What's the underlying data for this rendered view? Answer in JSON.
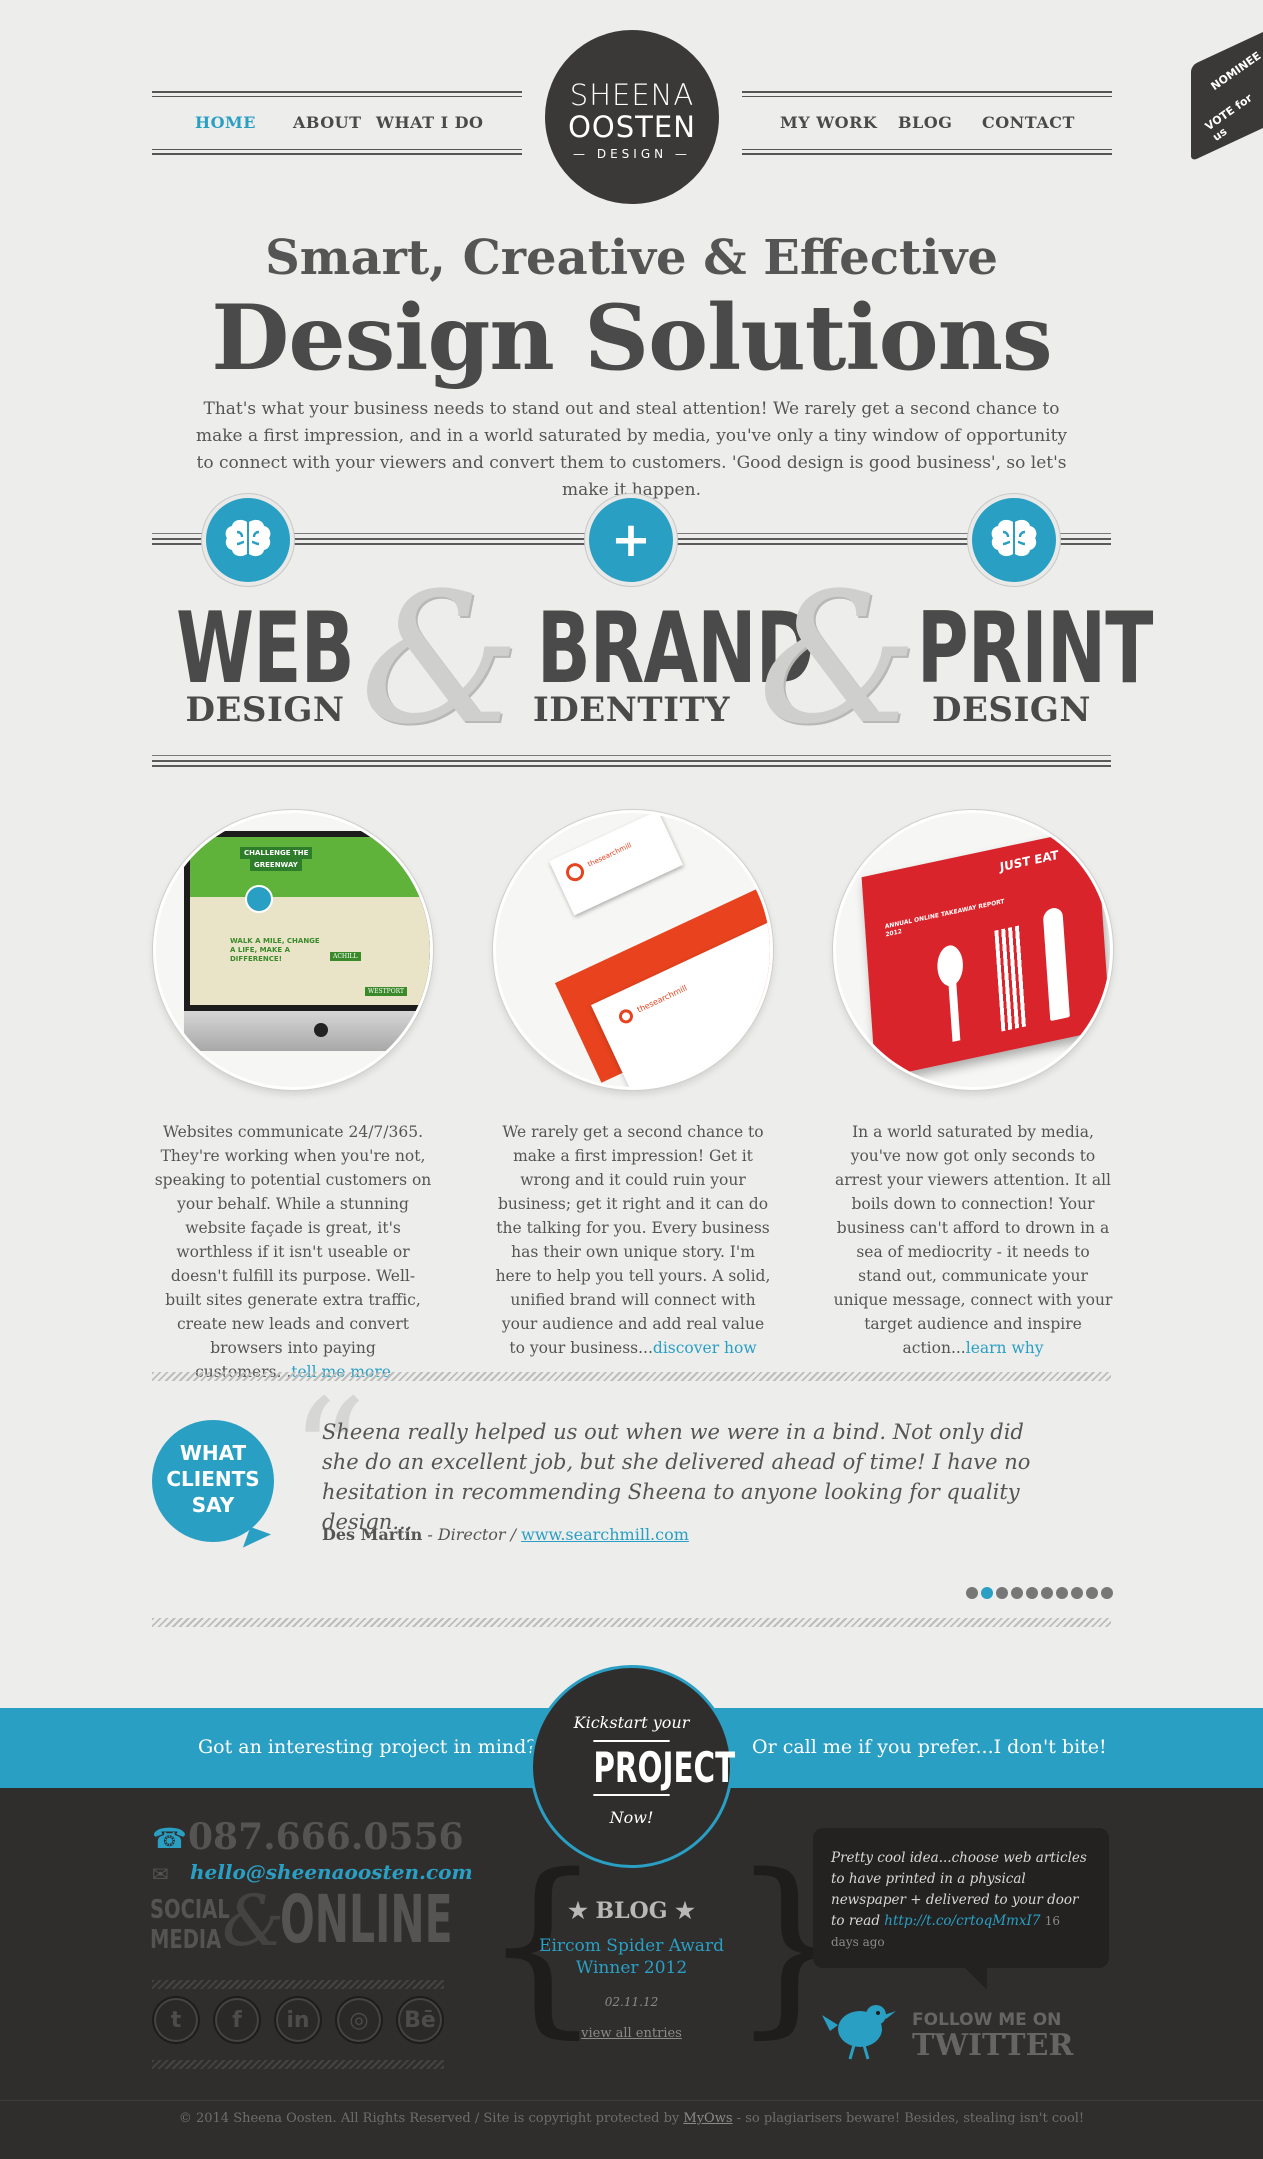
{
  "badge": {
    "line1": "NOMINEE",
    "line2": "VOTE for us"
  },
  "nav": {
    "home": "HOME",
    "about": "ABOUT",
    "whatido": "WHAT I DO",
    "mywork": "MY WORK",
    "blog": "BLOG",
    "contact": "CONTACT"
  },
  "logo": {
    "line1": "SHEENA",
    "line2": "OOSTEN",
    "line3": "— DESIGN —"
  },
  "hero": {
    "subtitle": "Smart, Creative & Effective",
    "title": "Design Solutions",
    "intro": "That's what your business needs to stand out and steal attention! We rarely get a second chance to make a first impression, and in a world saturated by media, you've only a tiny window of opportunity to connect with your viewers and convert them to customers. 'Good design is good business', so let's make it happen."
  },
  "services": [
    {
      "big": "WEB",
      "small": "DESIGN",
      "icon": "brain-icon"
    },
    {
      "big": "BRAND",
      "small": "IDENTITY",
      "icon": "plus-icon"
    },
    {
      "big": "PRINT",
      "small": "DESIGN",
      "icon": "brain-icon"
    }
  ],
  "ampersand": "&",
  "portfolio": [
    {
      "text": "Websites communicate 24/7/365. They're working when you're not, speaking to potential customers on your behalf. While a stunning website façade is great, it's worthless if it isn't useable or doesn't fulfill its purpose. Well-built sites generate extra traffic, create new leads and convert browsers into paying customers...",
      "link": "tell me more",
      "mock": {
        "t1": "CHALLENGE THE",
        "t2": "GREENWAY",
        "t3": "WALK A MILE, CHANGE A LIFE, MAKE A DIFFERENCE!",
        "t4": "ACHILL",
        "t5": "WESTPORT"
      }
    },
    {
      "text": "We rarely get a second chance to make a first impression! Get it wrong and it could ruin your business; get it right and it can do the talking for you. Every business has their own unique story. I'm here to help you tell yours. A solid, unified brand will connect with your audience and add real value to your business...",
      "link": "discover how",
      "mock": {
        "t1": "thesearchmill"
      }
    },
    {
      "text": "In a world saturated by media, you've now got only seconds to arrest your viewers attention. It all boils down to connection! Your business can't afford to drown in a sea of mediocrity - it needs to stand out, communicate your unique message, connect with your target audience and inspire action...",
      "link": "learn why",
      "mock": {
        "t1": "JUST EAT",
        "t2": "ANNUAL ONLINE TAKEAWAY REPORT 2012"
      }
    }
  ],
  "testimonial": {
    "bubble_l1": "WHAT",
    "bubble_l2": "CLIENTS",
    "bubble_l3": "SAY",
    "quote": "Sheena really helped us out when we were in a bind. Not only did she do an excellent job, but she delivered ahead of time! I have no hesitation in recommending Sheena to anyone looking for quality design...",
    "author": "Des Martin",
    "role": " - Director / ",
    "site": "www.searchmill.com",
    "dots_total": 10,
    "dots_active": 2
  },
  "cta": {
    "left": "Got an interesting project in mind?",
    "right": "Or call me if you prefer...I don't bite!",
    "k1": "Kickstart your",
    "k2": "PROJECT",
    "k3": "Now!"
  },
  "footer": {
    "phone": "087.666.0556",
    "email": "hello@sheenaoosten.com",
    "social1": "SOCIAL",
    "social2": "MEDIA",
    "online": "ONLINE",
    "icons": [
      {
        "name": "twitter-icon",
        "glyph": "t"
      },
      {
        "name": "facebook-icon",
        "glyph": "f"
      },
      {
        "name": "linkedin-icon",
        "glyph": "in"
      },
      {
        "name": "dribbble-icon",
        "glyph": "◎"
      },
      {
        "name": "behance-icon",
        "glyph": "Bē"
      }
    ],
    "blog_title": "BLOG",
    "blog_post": "Eircom Spider Award Winner 2012",
    "blog_date": "02.11.12",
    "blog_all": "view all entries",
    "tweet": "Pretty cool idea...choose web articles to have printed in a physical newspaper + delivered to your door to read",
    "tweet_link": "http://t.co/crtoqMmxI7",
    "tweet_time": "16 days ago",
    "follow1": "FOLLOW ME ON",
    "follow2": "TWITTER",
    "copyright": "© 2014 Sheena Oosten. All Rights Reserved / Site is copyright protected by ",
    "copyright_link": "MyOws",
    "copyright_end": " - so plagiarisers beware! Besides, stealing isn't cool!"
  },
  "colors": {
    "accent": "#2a9fc4",
    "dark": "#2f2e2d",
    "bg": "#ededeb"
  }
}
